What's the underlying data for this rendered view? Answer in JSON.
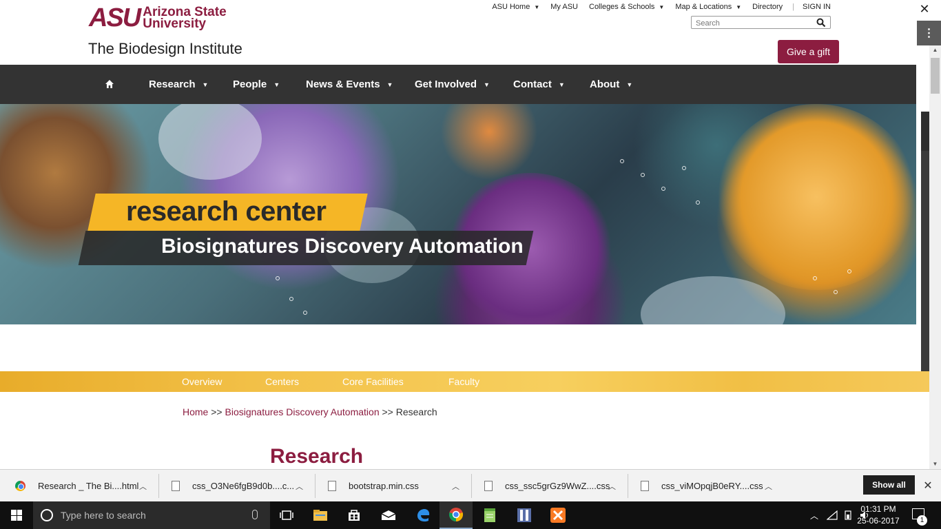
{
  "header": {
    "logo_mark": "ASU",
    "logo_line1": "Arizona State",
    "logo_line2": "University",
    "site_title": "The Biodesign Institute",
    "util_nav": {
      "asu_home": "ASU Home",
      "my_asu": "My ASU",
      "colleges": "Colleges & Schools",
      "map": "Map & Locations",
      "directory": "Directory",
      "sign_in": "SIGN IN"
    },
    "search_placeholder": "Search",
    "gift_label": "Give a gift",
    "close_glyph": "✕",
    "menu_glyph": "⋮"
  },
  "main_nav": {
    "items": [
      "Research",
      "People",
      "News & Events",
      "Get Involved",
      "Contact",
      "About"
    ]
  },
  "hero": {
    "kicker": "research center",
    "title": "Biosignatures Discovery Automation"
  },
  "sub_nav": {
    "items": [
      "Overview",
      "Centers",
      "Core Facilities",
      "Faculty"
    ]
  },
  "breadcrumb": {
    "home": "Home",
    "sep": ">>",
    "center": "Biosignatures Discovery Automation",
    "current": "Research"
  },
  "page": {
    "title": "Research"
  },
  "download_bar": {
    "items": [
      "Research _ The Bi....html",
      "css_O3Ne6fgB9d0b....c...",
      "bootstrap.min.css",
      "css_ssc5grGz9WwZ....css",
      "css_viMOpqjB0eRY....css"
    ],
    "show_all": "Show all"
  },
  "taskbar": {
    "search_placeholder": "Type here to search",
    "time": "01:31 PM",
    "date": "25-06-2017",
    "notif_count": "1"
  },
  "colors": {
    "asu_maroon": "#8c1d40",
    "asu_gold": "#f5b626",
    "nav_bg": "#333333"
  }
}
